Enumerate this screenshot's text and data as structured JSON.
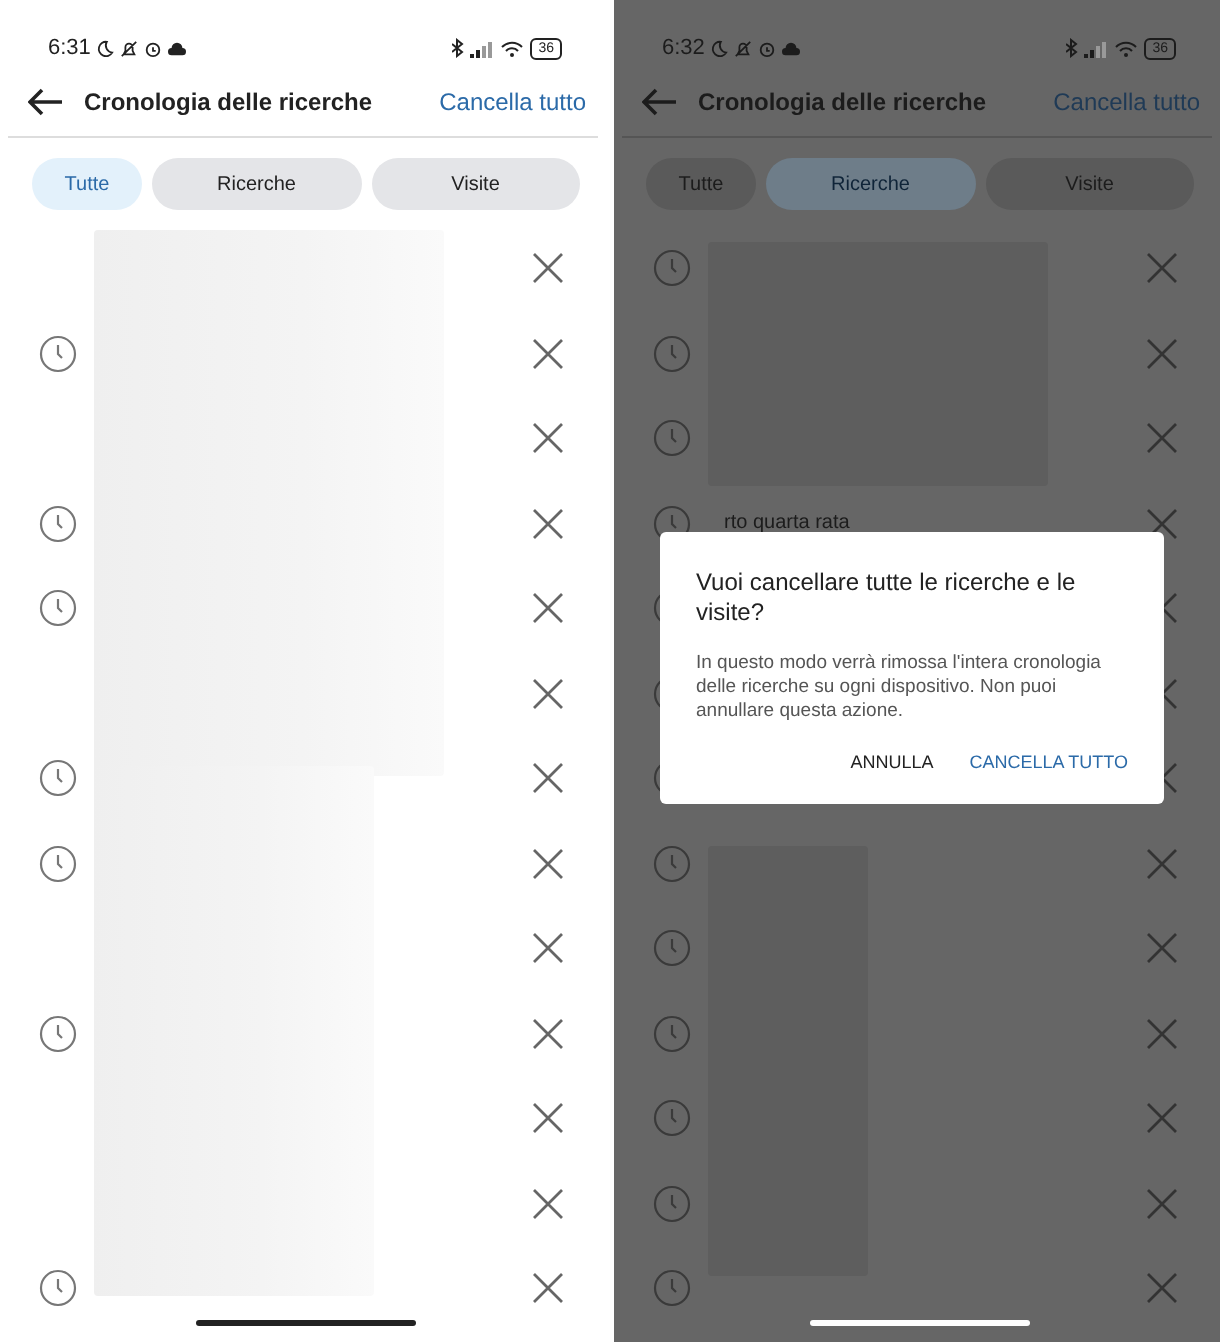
{
  "screens": [
    {
      "dimmed": false,
      "status": {
        "time": "6:31",
        "battery": "36"
      },
      "header": {
        "title": "Cronologia delle ricerche",
        "action": "Cancella tutto"
      },
      "tabs": [
        {
          "label": "Tutte",
          "selected": true
        },
        {
          "label": "Ricerche",
          "selected": false
        },
        {
          "label": "Visite",
          "selected": false
        }
      ],
      "rows": [
        {
          "clock": false
        },
        {
          "clock": true
        },
        {
          "clock": false
        },
        {
          "clock": true
        },
        {
          "clock": true
        },
        {
          "clock": false
        },
        {
          "clock": true
        },
        {
          "clock": true
        },
        {
          "clock": false
        },
        {
          "clock": true
        },
        {
          "clock": false
        },
        {
          "clock": false
        },
        {
          "clock": true
        }
      ]
    },
    {
      "dimmed": true,
      "status": {
        "time": "6:32",
        "battery": "36"
      },
      "header": {
        "title": "Cronologia delle ricerche",
        "action": "Cancella tutto"
      },
      "tabs": [
        {
          "label": "Tutte",
          "selected": false
        },
        {
          "label": "Ricerche",
          "selected": true
        },
        {
          "label": "Visite",
          "selected": false
        }
      ],
      "rows": [
        {
          "clock": true
        },
        {
          "clock": true
        },
        {
          "clock": true
        },
        {
          "clock": true,
          "text": "rto quarta rata"
        },
        {
          "clock": true
        },
        {
          "clock": true
        },
        {
          "clock": true
        },
        {
          "clock": true
        },
        {
          "clock": true
        },
        {
          "clock": true
        },
        {
          "clock": true
        },
        {
          "clock": true
        },
        {
          "clock": true
        }
      ],
      "dialog": {
        "title": "Vuoi cancellare tutte le ricerche e le visite?",
        "message": "In questo modo verrà rimossa l'intera cronologia delle ricerche su ogni dispositivo. Non puoi annullare questa azione.",
        "buttons": [
          {
            "label": "ANNULLA",
            "kind": "neutral"
          },
          {
            "label": "CANCELLA TUTTO",
            "kind": "accent"
          }
        ]
      }
    }
  ]
}
